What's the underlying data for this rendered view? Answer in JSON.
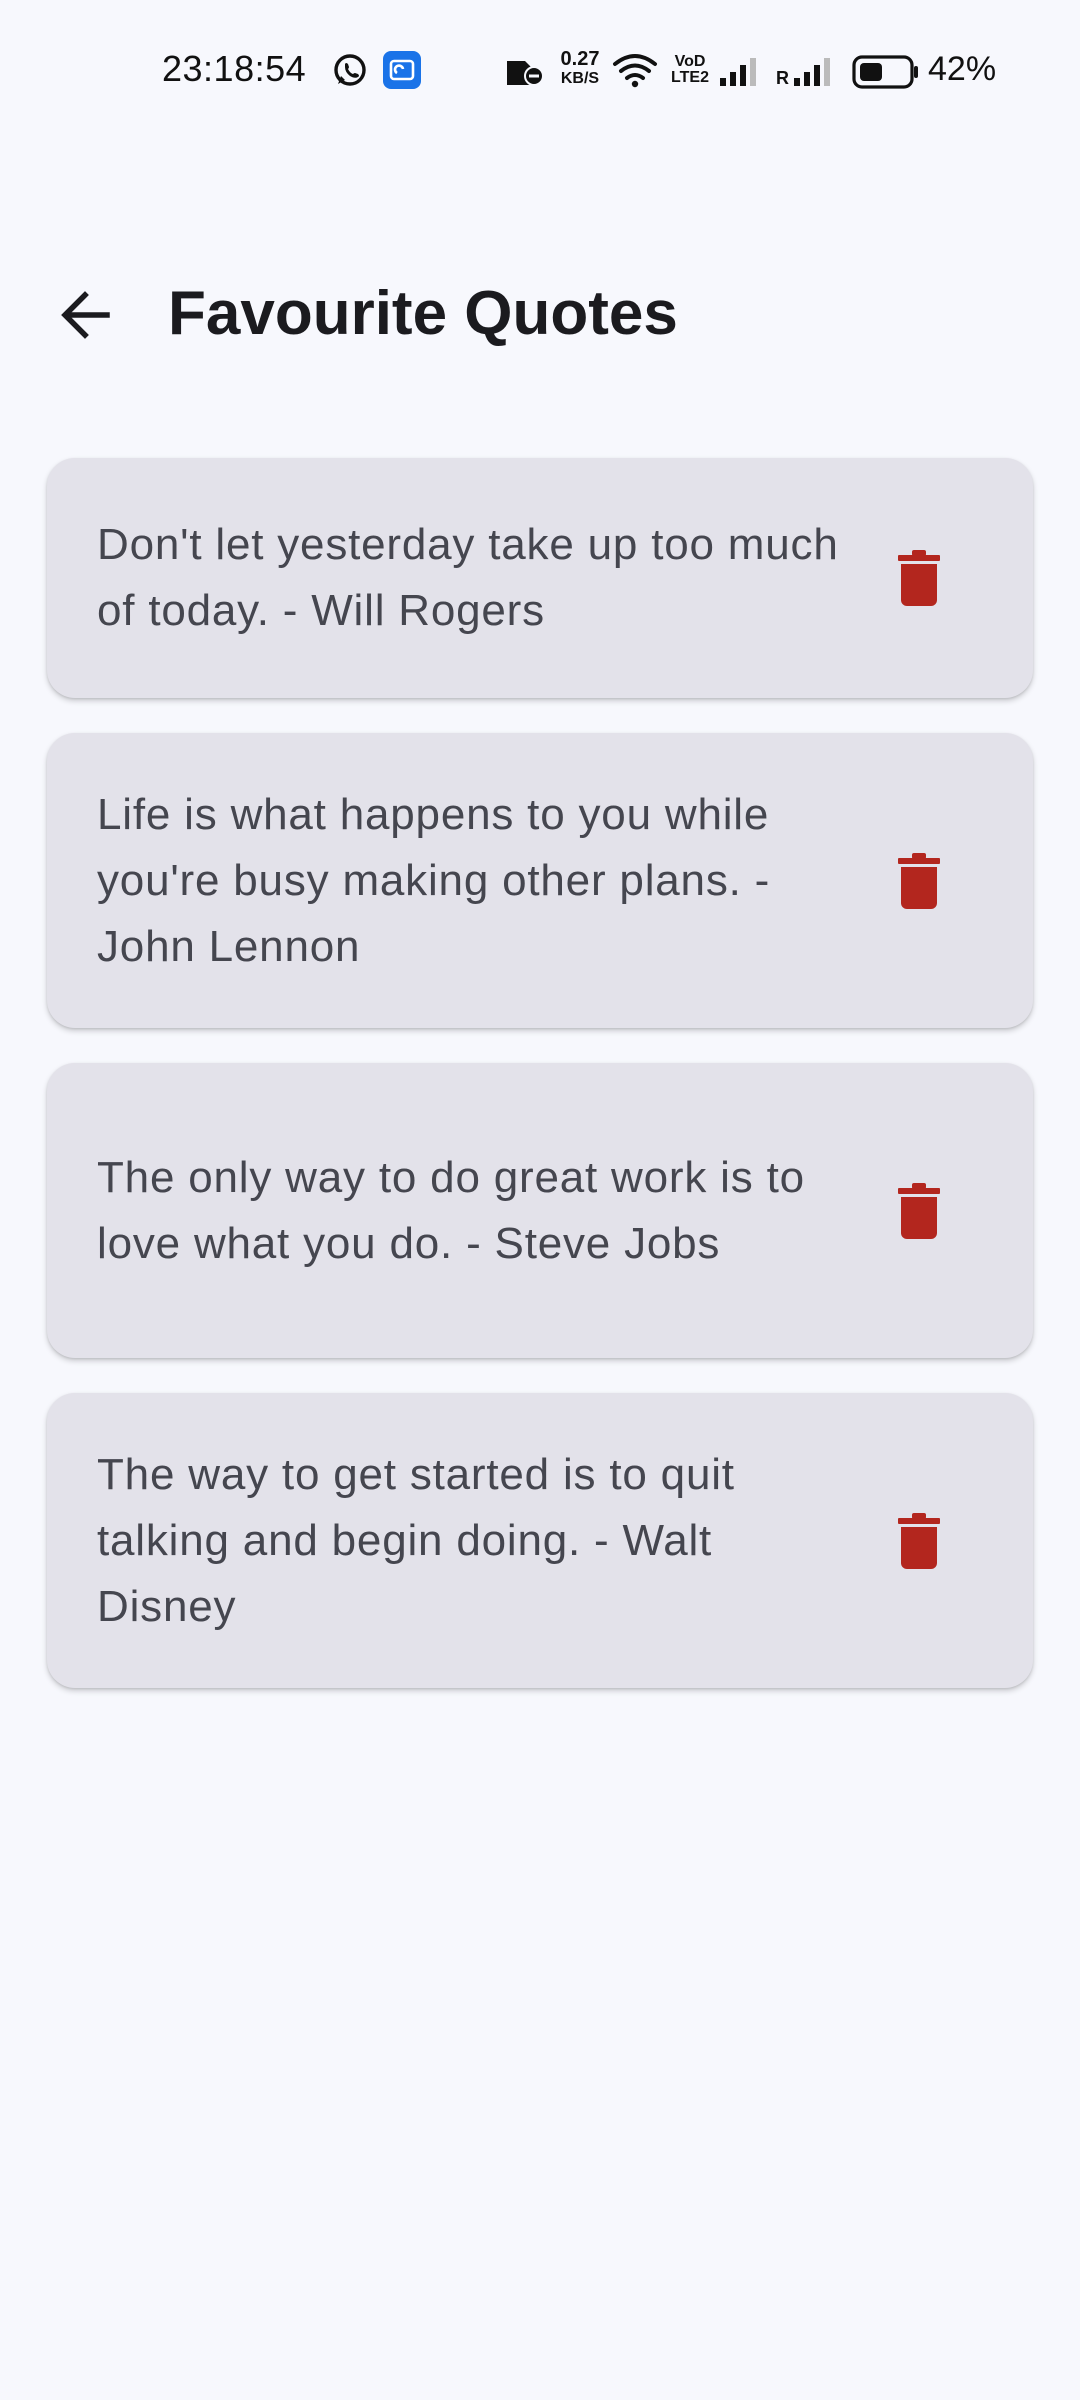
{
  "status_bar": {
    "time": "23:18:54",
    "net_speed_value": "0.27",
    "net_speed_unit": "KB/S",
    "volte_top": "VoD",
    "volte_bottom": "LTE2",
    "roaming_label": "R",
    "battery_percent": "42%",
    "icons": [
      "whatsapp-icon",
      "app-notification-icon",
      "no-sim-icon",
      "wifi-icon",
      "signal-icon",
      "battery-icon"
    ]
  },
  "app_bar": {
    "title": "Favourite Quotes",
    "back_icon": "arrow-back-icon"
  },
  "quotes": [
    {
      "text": "Don't let yesterday take up too much of today. - Will Rogers"
    },
    {
      "text": "Life is what happens to you while you're busy making other plans. - John Lennon"
    },
    {
      "text": "The only way to do great work is to love what you do. - Steve Jobs"
    },
    {
      "text": "The way to get started is to quit talking and begin doing. - Walt Disney"
    }
  ],
  "colors": {
    "background": "#f7f8fd",
    "card": "#e3e2ea",
    "delete_icon": "#b3261e",
    "title": "#1b1b1f",
    "quote_text": "#45464f"
  }
}
